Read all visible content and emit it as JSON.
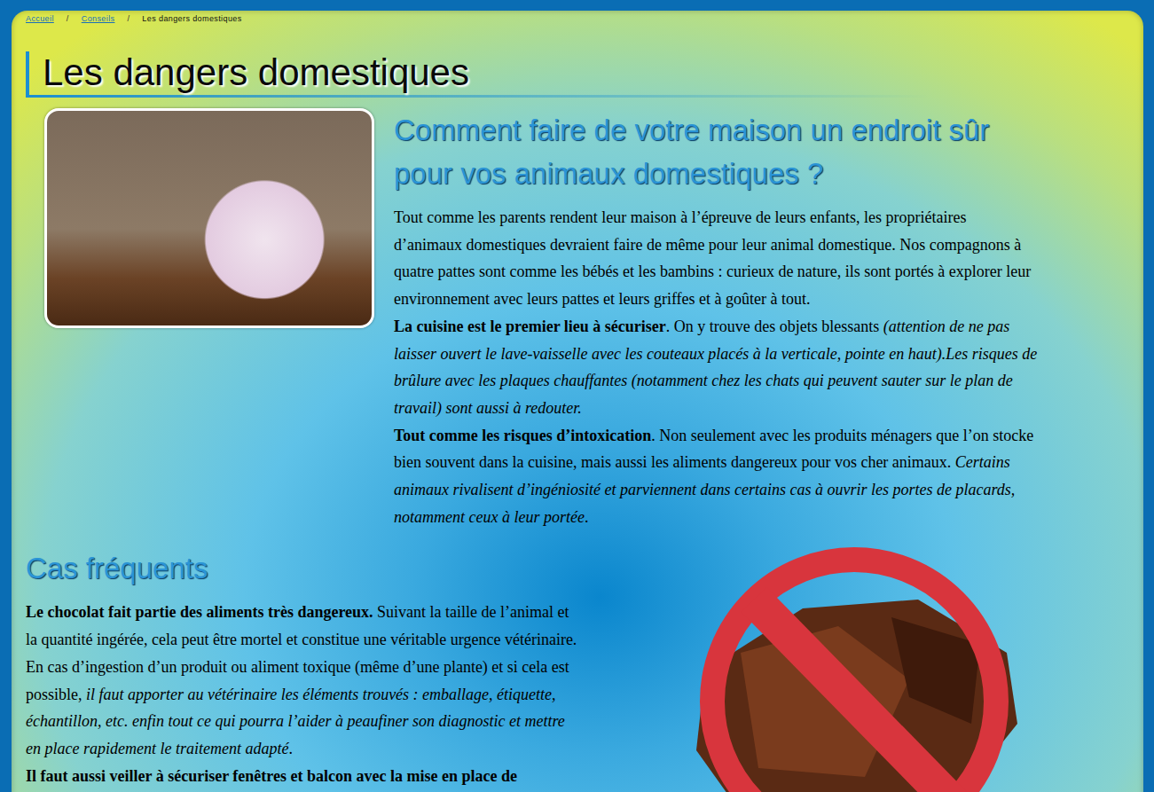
{
  "breadcrumb": {
    "separator": "/",
    "items": [
      {
        "label": "Accueil",
        "link": true
      },
      {
        "label": "Conseils",
        "link": true
      },
      {
        "label": "Les dangers domestiques",
        "link": false
      }
    ]
  },
  "page_title": "Les dangers domestiques",
  "intro": {
    "heading": "Comment faire de votre maison un endroit sûr pour vos animaux domestiques ?",
    "paragraphs": [
      [
        {
          "text": "Tout comme les parents rendent leur maison à l’épreuve de leurs enfants, les propriétaires d’animaux domestiques devraient faire de même pour leur animal domestique. Nos compagnons à quatre pattes sont comme les bébés et les bambins : curieux de nature, ils sont portés à explorer leur environnement avec leurs pattes et leurs griffes et à goûter à tout.",
          "style": "normal"
        }
      ],
      [
        {
          "text": "La cuisine est le premier lieu à sécuriser",
          "style": "bold"
        },
        {
          "text": ". On y trouve des objets blessants ",
          "style": "normal"
        },
        {
          "text": "(attention de ne pas laisser ouvert le lave-vaisselle avec les couteaux placés à la verticale, pointe en haut).Les risques de brûlure avec les plaques chauffantes (notamment chez les chats qui peuvent sauter sur le plan de travail) sont aussi à redouter.",
          "style": "italic"
        }
      ],
      [
        {
          "text": "Tout comme les risques d’intoxication",
          "style": "bold"
        },
        {
          "text": ". Non seulement avec les produits ménagers que l’on stocke bien souvent dans la cuisine, mais aussi les aliments dangereux pour vos cher animaux. ",
          "style": "normal"
        },
        {
          "text": "Certains animaux rivalisent d’ingéniosité et parviennent dans certains cas à ouvrir les portes de placards, notamment ceux à leur portée",
          "style": "italic"
        },
        {
          "text": ".",
          "style": "normal"
        }
      ]
    ]
  },
  "section": {
    "heading": "Cas fréquents",
    "paragraphs": [
      [
        {
          "text": "Le chocolat fait partie des aliments très dangereux.",
          "style": "bold"
        },
        {
          "text": " Suivant la taille de l’animal et la quantité ingérée, cela peut être mortel et constitue une véritable urgence vétérinaire. En cas d’ingestion d’un produit ou aliment toxique (même d’une plante) et si cela est possible, ",
          "style": "normal"
        },
        {
          "text": "il faut apporter au vétérinaire les éléments trouvés : emballage, étiquette, échantillon, etc. enfin tout ce qui pourra l’aider à peaufiner son diagnostic et mettre en place rapidement le traitement adapté",
          "style": "italic"
        },
        {
          "text": ".",
          "style": "normal"
        }
      ],
      [
        {
          "text": "Il faut aussi veiller à sécuriser fenêtres et balcon avec la mise en place de",
          "style": "bold"
        }
      ]
    ]
  }
}
